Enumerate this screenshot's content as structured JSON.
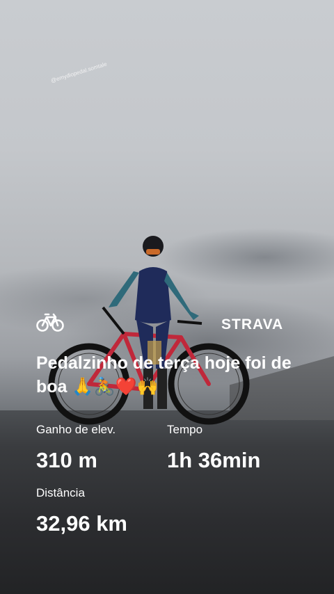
{
  "watermark": "@emydiopedal.somtale",
  "activity": {
    "icon": "bicycle-icon",
    "brand": "STRAVA",
    "title": "Pedalzinho de terça hoje foi de boa 🙏🚴❤️🙌"
  },
  "stats": {
    "elevation": {
      "label": "Ganho de elev.",
      "value": "310 m"
    },
    "time": {
      "label": "Tempo",
      "value": "1h 36min"
    },
    "distance": {
      "label": "Distância",
      "value": "32,96 km"
    }
  },
  "colors": {
    "text": "#ffffff",
    "bike_frame": "#c0283a",
    "kit": "#1f2b5a"
  }
}
